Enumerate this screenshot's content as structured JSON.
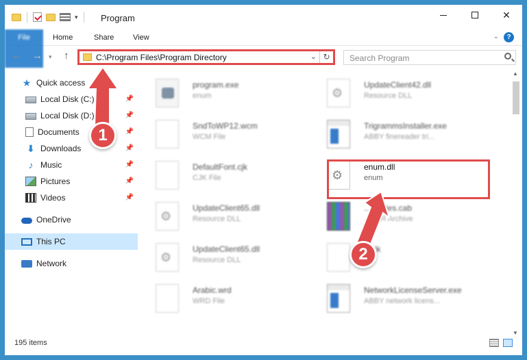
{
  "window": {
    "title": "Program",
    "minimize": "",
    "maximize": "",
    "close": "✕"
  },
  "ribbon": {
    "tabs": [
      "File",
      "Home",
      "Share",
      "View"
    ],
    "help": "?"
  },
  "address": {
    "path": "C:\\Program Files\\Program Directory",
    "refresh": "↻"
  },
  "search": {
    "placeholder": "Search Program"
  },
  "sidebar": {
    "items": [
      {
        "label": "Quick access",
        "icon": "star-icon",
        "pinned": false
      },
      {
        "label": "Local Disk (C:)",
        "icon": "disk-icon",
        "pinned": true
      },
      {
        "label": "Local Disk (D:)",
        "icon": "disk-icon",
        "pinned": true
      },
      {
        "label": "Documents",
        "icon": "documents-icon",
        "pinned": true
      },
      {
        "label": "Downloads",
        "icon": "downloads-icon",
        "pinned": true
      },
      {
        "label": "Music",
        "icon": "music-icon",
        "pinned": true
      },
      {
        "label": "Pictures",
        "icon": "pictures-icon",
        "pinned": true
      },
      {
        "label": "Videos",
        "icon": "videos-icon",
        "pinned": true
      },
      {
        "label": "OneDrive",
        "icon": "onedrive-icon",
        "pinned": false
      },
      {
        "label": "This PC",
        "icon": "this-pc-icon",
        "pinned": false,
        "selected": true
      },
      {
        "label": "Network",
        "icon": "network-icon",
        "pinned": false
      }
    ]
  },
  "files": [
    {
      "name": "program.exe",
      "type": "enum",
      "icon": "program-icon"
    },
    {
      "name": "UpdateClient42.dll",
      "type": "Resource DLL",
      "icon": "dll-gear-icon"
    },
    {
      "name": "SndToWP12.wcm",
      "type": "WCM File",
      "icon": "file-icon"
    },
    {
      "name": "TrigrammsInstaller.exe",
      "type": "ABBY finereader tri...",
      "icon": "exe-icon"
    },
    {
      "name": "DefaultFont.cjk",
      "type": "CJK File",
      "icon": "file-icon"
    },
    {
      "name": "enum.dll",
      "type": "enum",
      "icon": "dll-gear-icon",
      "highlighted": true
    },
    {
      "name": "UpdateClient65.dll",
      "type": "Resource DLL",
      "icon": "dll-gear-icon"
    },
    {
      "name": "...ificates.cab",
      "type": "...RAR Archive",
      "icon": "archive-icon"
    },
    {
      "name": "UpdateClient65.dll",
      "type": "Resource DLL",
      "icon": "dll-gear-icon"
    },
    {
      "name": "...cjk",
      "type": "...e",
      "icon": "file-icon"
    },
    {
      "name": "Arabic.wrd",
      "type": "WRD File",
      "icon": "file-icon"
    },
    {
      "name": "NetworkLicenseServer.exe",
      "type": "ABBY network licens...",
      "icon": "exe-icon"
    }
  ],
  "status": {
    "count": "195 items"
  },
  "annotations": {
    "step1": "1",
    "step2": "2",
    "color": "#e04b4b"
  }
}
